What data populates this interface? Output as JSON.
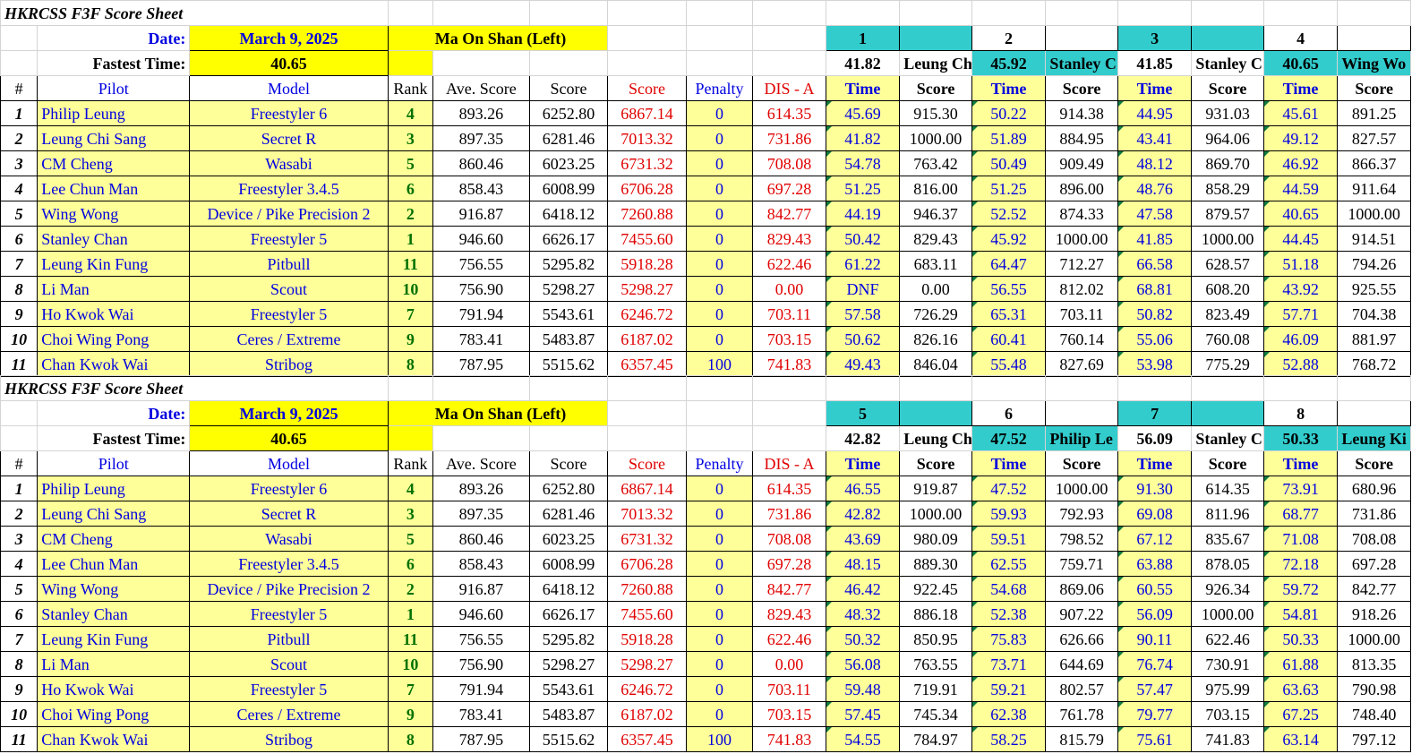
{
  "sheets": [
    {
      "title": "HKRCSS F3F Score Sheet",
      "date_label": "Date:",
      "date": "March 9, 2025",
      "venue": "Ma On Shan (Left)",
      "fastest_label": "Fastest Time:",
      "fastest": "40.65",
      "rounds": [
        {
          "num": "1",
          "best_time": "41.82",
          "best_pilot": "Leung Ch"
        },
        {
          "num": "2",
          "best_time": "45.92",
          "best_pilot": "Stanley C"
        },
        {
          "num": "3",
          "best_time": "41.85",
          "best_pilot": "Stanley C"
        },
        {
          "num": "4",
          "best_time": "40.65",
          "best_pilot": "Wing Wo"
        }
      ],
      "headers": {
        "num": "#",
        "pilot": "Pilot",
        "model": "Model",
        "rank": "Rank",
        "ave": "Ave. Score",
        "score": "Score",
        "score2": "Score",
        "penalty": "Penalty",
        "dis": "DIS - A",
        "time": "Time",
        "rscore": "Score"
      },
      "rows": [
        {
          "n": "1",
          "pilot": "Philip Leung",
          "model": "Freestyler 6",
          "rank": "4",
          "ave": "893.26",
          "score": "6252.80",
          "score2": "6867.14",
          "penalty": "0",
          "dis": "614.35",
          "r": [
            [
              "45.69",
              "915.30"
            ],
            [
              "50.22",
              "914.38"
            ],
            [
              "44.95",
              "931.03"
            ],
            [
              "45.61",
              "891.25"
            ]
          ]
        },
        {
          "n": "2",
          "pilot": "Leung Chi Sang",
          "model": "Secret R",
          "rank": "3",
          "ave": "897.35",
          "score": "6281.46",
          "score2": "7013.32",
          "penalty": "0",
          "dis": "731.86",
          "r": [
            [
              "41.82",
              "1000.00"
            ],
            [
              "51.89",
              "884.95"
            ],
            [
              "43.41",
              "964.06"
            ],
            [
              "49.12",
              "827.57"
            ]
          ]
        },
        {
          "n": "3",
          "pilot": "CM Cheng",
          "model": "Wasabi",
          "rank": "5",
          "ave": "860.46",
          "score": "6023.25",
          "score2": "6731.32",
          "penalty": "0",
          "dis": "708.08",
          "r": [
            [
              "54.78",
              "763.42"
            ],
            [
              "50.49",
              "909.49"
            ],
            [
              "48.12",
              "869.70"
            ],
            [
              "46.92",
              "866.37"
            ]
          ]
        },
        {
          "n": "4",
          "pilot": "Lee Chun Man",
          "model": "Freestyler 3.4.5",
          "rank": "6",
          "ave": "858.43",
          "score": "6008.99",
          "score2": "6706.28",
          "penalty": "0",
          "dis": "697.28",
          "r": [
            [
              "51.25",
              "816.00"
            ],
            [
              "51.25",
              "896.00"
            ],
            [
              "48.76",
              "858.29"
            ],
            [
              "44.59",
              "911.64"
            ]
          ]
        },
        {
          "n": "5",
          "pilot": "Wing Wong",
          "model": "Device / Pike Precision 2",
          "rank": "2",
          "ave": "916.87",
          "score": "6418.12",
          "score2": "7260.88",
          "penalty": "0",
          "dis": "842.77",
          "r": [
            [
              "44.19",
              "946.37"
            ],
            [
              "52.52",
              "874.33"
            ],
            [
              "47.58",
              "879.57"
            ],
            [
              "40.65",
              "1000.00"
            ]
          ]
        },
        {
          "n": "6",
          "pilot": "Stanley Chan",
          "model": "Freestyler 5",
          "rank": "1",
          "ave": "946.60",
          "score": "6626.17",
          "score2": "7455.60",
          "penalty": "0",
          "dis": "829.43",
          "r": [
            [
              "50.42",
              "829.43"
            ],
            [
              "45.92",
              "1000.00"
            ],
            [
              "41.85",
              "1000.00"
            ],
            [
              "44.45",
              "914.51"
            ]
          ]
        },
        {
          "n": "7",
          "pilot": "Leung Kin Fung",
          "model": "Pitbull",
          "rank": "11",
          "ave": "756.55",
          "score": "5295.82",
          "score2": "5918.28",
          "penalty": "0",
          "dis": "622.46",
          "r": [
            [
              "61.22",
              "683.11"
            ],
            [
              "64.47",
              "712.27"
            ],
            [
              "66.58",
              "628.57"
            ],
            [
              "51.18",
              "794.26"
            ]
          ]
        },
        {
          "n": "8",
          "pilot": "Li Man",
          "model": "Scout",
          "rank": "10",
          "ave": "756.90",
          "score": "5298.27",
          "score2": "5298.27",
          "penalty": "0",
          "dis": "0.00",
          "r": [
            [
              "DNF",
              "0.00"
            ],
            [
              "56.55",
              "812.02"
            ],
            [
              "68.81",
              "608.20"
            ],
            [
              "43.92",
              "925.55"
            ]
          ]
        },
        {
          "n": "9",
          "pilot": "Ho Kwok Wai",
          "model": "Freestyler 5",
          "rank": "7",
          "ave": "791.94",
          "score": "5543.61",
          "score2": "6246.72",
          "penalty": "0",
          "dis": "703.11",
          "r": [
            [
              "57.58",
              "726.29"
            ],
            [
              "65.31",
              "703.11"
            ],
            [
              "50.82",
              "823.49"
            ],
            [
              "57.71",
              "704.38"
            ]
          ]
        },
        {
          "n": "10",
          "pilot": "Choi Wing Pong",
          "model": "Ceres / Extreme",
          "rank": "9",
          "ave": "783.41",
          "score": "5483.87",
          "score2": "6187.02",
          "penalty": "0",
          "dis": "703.15",
          "r": [
            [
              "50.62",
              "826.16"
            ],
            [
              "60.41",
              "760.14"
            ],
            [
              "55.06",
              "760.08"
            ],
            [
              "46.09",
              "881.97"
            ]
          ]
        },
        {
          "n": "11",
          "pilot": "Chan Kwok Wai",
          "model": "Stribog",
          "rank": "8",
          "ave": "787.95",
          "score": "5515.62",
          "score2": "6357.45",
          "penalty": "100",
          "dis": "741.83",
          "r": [
            [
              "49.43",
              "846.04"
            ],
            [
              "55.48",
              "827.69"
            ],
            [
              "53.98",
              "775.29"
            ],
            [
              "52.88",
              "768.72"
            ]
          ]
        }
      ]
    },
    {
      "title": "HKRCSS F3F Score Sheet",
      "date_label": "Date:",
      "date": "March 9, 2025",
      "venue": "Ma On Shan (Left)",
      "fastest_label": "Fastest Time:",
      "fastest": "40.65",
      "rounds": [
        {
          "num": "5",
          "best_time": "42.82",
          "best_pilot": "Leung Ch"
        },
        {
          "num": "6",
          "best_time": "47.52",
          "best_pilot": "Philip Le"
        },
        {
          "num": "7",
          "best_time": "56.09",
          "best_pilot": "Stanley C"
        },
        {
          "num": "8",
          "best_time": "50.33",
          "best_pilot": "Leung Ki"
        }
      ],
      "headers": {
        "num": "#",
        "pilot": "Pilot",
        "model": "Model",
        "rank": "Rank",
        "ave": "Ave. Score",
        "score": "Score",
        "score2": "Score",
        "penalty": "Penalty",
        "dis": "DIS - A",
        "time": "Time",
        "rscore": "Score"
      },
      "rows": [
        {
          "n": "1",
          "pilot": "Philip Leung",
          "model": "Freestyler 6",
          "rank": "4",
          "ave": "893.26",
          "score": "6252.80",
          "score2": "6867.14",
          "penalty": "0",
          "dis": "614.35",
          "r": [
            [
              "46.55",
              "919.87"
            ],
            [
              "47.52",
              "1000.00"
            ],
            [
              "91.30",
              "614.35"
            ],
            [
              "73.91",
              "680.96"
            ]
          ]
        },
        {
          "n": "2",
          "pilot": "Leung Chi Sang",
          "model": "Secret R",
          "rank": "3",
          "ave": "897.35",
          "score": "6281.46",
          "score2": "7013.32",
          "penalty": "0",
          "dis": "731.86",
          "r": [
            [
              "42.82",
              "1000.00"
            ],
            [
              "59.93",
              "792.93"
            ],
            [
              "69.08",
              "811.96"
            ],
            [
              "68.77",
              "731.86"
            ]
          ]
        },
        {
          "n": "3",
          "pilot": "CM Cheng",
          "model": "Wasabi",
          "rank": "5",
          "ave": "860.46",
          "score": "6023.25",
          "score2": "6731.32",
          "penalty": "0",
          "dis": "708.08",
          "r": [
            [
              "43.69",
              "980.09"
            ],
            [
              "59.51",
              "798.52"
            ],
            [
              "67.12",
              "835.67"
            ],
            [
              "71.08",
              "708.08"
            ]
          ]
        },
        {
          "n": "4",
          "pilot": "Lee Chun Man",
          "model": "Freestyler 3.4.5",
          "rank": "6",
          "ave": "858.43",
          "score": "6008.99",
          "score2": "6706.28",
          "penalty": "0",
          "dis": "697.28",
          "r": [
            [
              "48.15",
              "889.30"
            ],
            [
              "62.55",
              "759.71"
            ],
            [
              "63.88",
              "878.05"
            ],
            [
              "72.18",
              "697.28"
            ]
          ]
        },
        {
          "n": "5",
          "pilot": "Wing Wong",
          "model": "Device / Pike Precision 2",
          "rank": "2",
          "ave": "916.87",
          "score": "6418.12",
          "score2": "7260.88",
          "penalty": "0",
          "dis": "842.77",
          "r": [
            [
              "46.42",
              "922.45"
            ],
            [
              "54.68",
              "869.06"
            ],
            [
              "60.55",
              "926.34"
            ],
            [
              "59.72",
              "842.77"
            ]
          ]
        },
        {
          "n": "6",
          "pilot": "Stanley Chan",
          "model": "Freestyler 5",
          "rank": "1",
          "ave": "946.60",
          "score": "6626.17",
          "score2": "7455.60",
          "penalty": "0",
          "dis": "829.43",
          "r": [
            [
              "48.32",
              "886.18"
            ],
            [
              "52.38",
              "907.22"
            ],
            [
              "56.09",
              "1000.00"
            ],
            [
              "54.81",
              "918.26"
            ]
          ]
        },
        {
          "n": "7",
          "pilot": "Leung Kin Fung",
          "model": "Pitbull",
          "rank": "11",
          "ave": "756.55",
          "score": "5295.82",
          "score2": "5918.28",
          "penalty": "0",
          "dis": "622.46",
          "r": [
            [
              "50.32",
              "850.95"
            ],
            [
              "75.83",
              "626.66"
            ],
            [
              "90.11",
              "622.46"
            ],
            [
              "50.33",
              "1000.00"
            ]
          ]
        },
        {
          "n": "8",
          "pilot": "Li Man",
          "model": "Scout",
          "rank": "10",
          "ave": "756.90",
          "score": "5298.27",
          "score2": "5298.27",
          "penalty": "0",
          "dis": "0.00",
          "r": [
            [
              "56.08",
              "763.55"
            ],
            [
              "73.71",
              "644.69"
            ],
            [
              "76.74",
              "730.91"
            ],
            [
              "61.88",
              "813.35"
            ]
          ]
        },
        {
          "n": "9",
          "pilot": "Ho Kwok Wai",
          "model": "Freestyler 5",
          "rank": "7",
          "ave": "791.94",
          "score": "5543.61",
          "score2": "6246.72",
          "penalty": "0",
          "dis": "703.11",
          "r": [
            [
              "59.48",
              "719.91"
            ],
            [
              "59.21",
              "802.57"
            ],
            [
              "57.47",
              "975.99"
            ],
            [
              "63.63",
              "790.98"
            ]
          ]
        },
        {
          "n": "10",
          "pilot": "Choi Wing Pong",
          "model": "Ceres / Extreme",
          "rank": "9",
          "ave": "783.41",
          "score": "5483.87",
          "score2": "6187.02",
          "penalty": "0",
          "dis": "703.15",
          "r": [
            [
              "57.45",
              "745.34"
            ],
            [
              "62.38",
              "761.78"
            ],
            [
              "79.77",
              "703.15"
            ],
            [
              "67.25",
              "748.40"
            ]
          ]
        },
        {
          "n": "11",
          "pilot": "Chan Kwok Wai",
          "model": "Stribog",
          "rank": "8",
          "ave": "787.95",
          "score": "5515.62",
          "score2": "6357.45",
          "penalty": "100",
          "dis": "741.83",
          "r": [
            [
              "54.55",
              "784.97"
            ],
            [
              "58.25",
              "815.79"
            ],
            [
              "75.61",
              "741.83"
            ],
            [
              "63.14",
              "797.12"
            ]
          ]
        }
      ]
    }
  ]
}
